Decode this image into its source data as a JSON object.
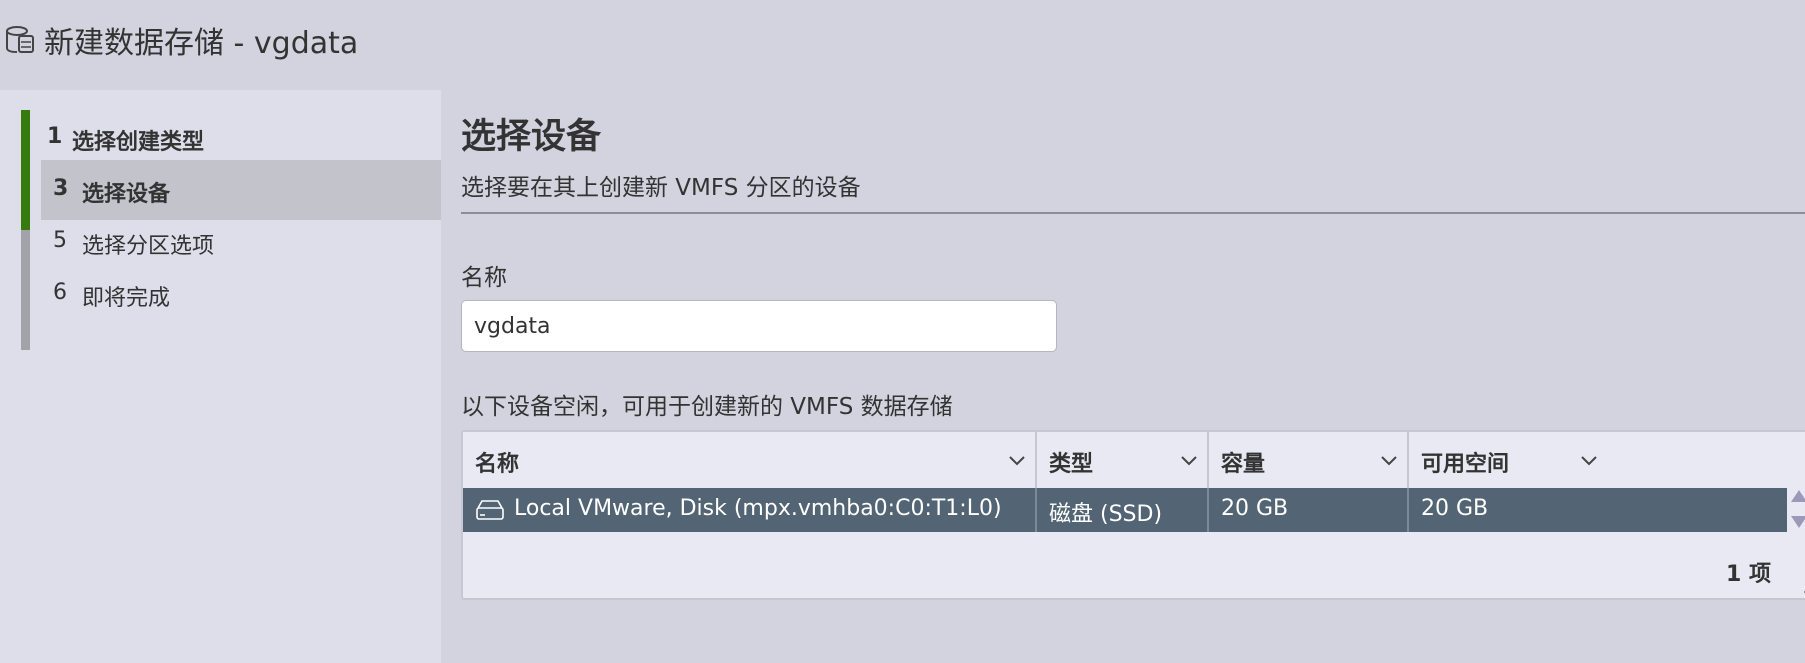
{
  "window": {
    "title": "新建数据存储 - vgdata",
    "icon": "datastore-icon"
  },
  "wizard": {
    "steps": [
      {
        "num": "1",
        "label": "选择创建类型",
        "state": "done"
      },
      {
        "num": "3",
        "label": "选择设备",
        "state": "current"
      },
      {
        "num": "5",
        "label": "选择分区选项",
        "state": "todo"
      },
      {
        "num": "6",
        "label": "即将完成",
        "state": "todo"
      }
    ],
    "colors": {
      "done": "#357b0e",
      "todo": "#a2a2a9"
    }
  },
  "page": {
    "heading": "选择设备",
    "subheading": "选择要在其上创建新 VMFS 分区的设备"
  },
  "name_field": {
    "label": "名称",
    "value": "vgdata"
  },
  "devices": {
    "info": "以下设备空闲，可用于创建新的 VMFS 数据存储",
    "columns": [
      "名称",
      "类型",
      "容量",
      "可用空间"
    ],
    "rows": [
      {
        "name": "Local VMware, Disk (mpx.vmhba0:C0:T1:L0)",
        "type": "磁盘 (SSD)",
        "capacity": "20 GB",
        "free": "20 GB",
        "icon": "disk-icon",
        "selected": true
      }
    ],
    "footer": "1 项",
    "selected_color": "#536574"
  }
}
